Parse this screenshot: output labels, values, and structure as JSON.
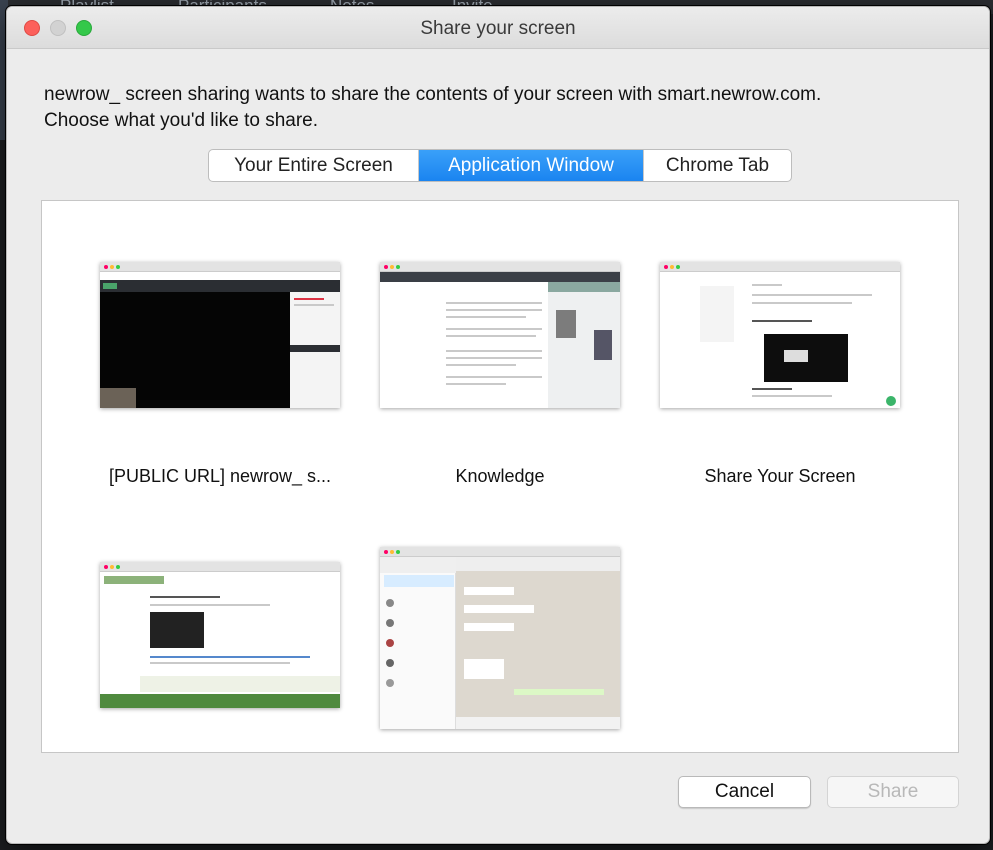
{
  "background": {
    "items": [
      "Playlist",
      "Participants",
      "Notes",
      "Invite"
    ]
  },
  "window": {
    "title": "Share your screen"
  },
  "message": {
    "line1": "newrow_ screen sharing wants to share the contents of your screen with smart.newrow.com.",
    "line2": "Choose what you'd like to share."
  },
  "tabs": [
    {
      "label": "Your Entire Screen",
      "selected": false
    },
    {
      "label": "Application Window",
      "selected": true
    },
    {
      "label": "Chrome Tab",
      "selected": false
    }
  ],
  "windows": [
    {
      "caption": "[PUBLIC URL] newrow_ s..."
    },
    {
      "caption": "Knowledge"
    },
    {
      "caption": "Share Your Screen"
    },
    {
      "caption": ""
    },
    {
      "caption": ""
    }
  ],
  "buttons": {
    "cancel": "Cancel",
    "share": "Share"
  },
  "colors": {
    "accent": "#1a84f0",
    "close": "#fc605b",
    "maximize": "#34c84a"
  }
}
